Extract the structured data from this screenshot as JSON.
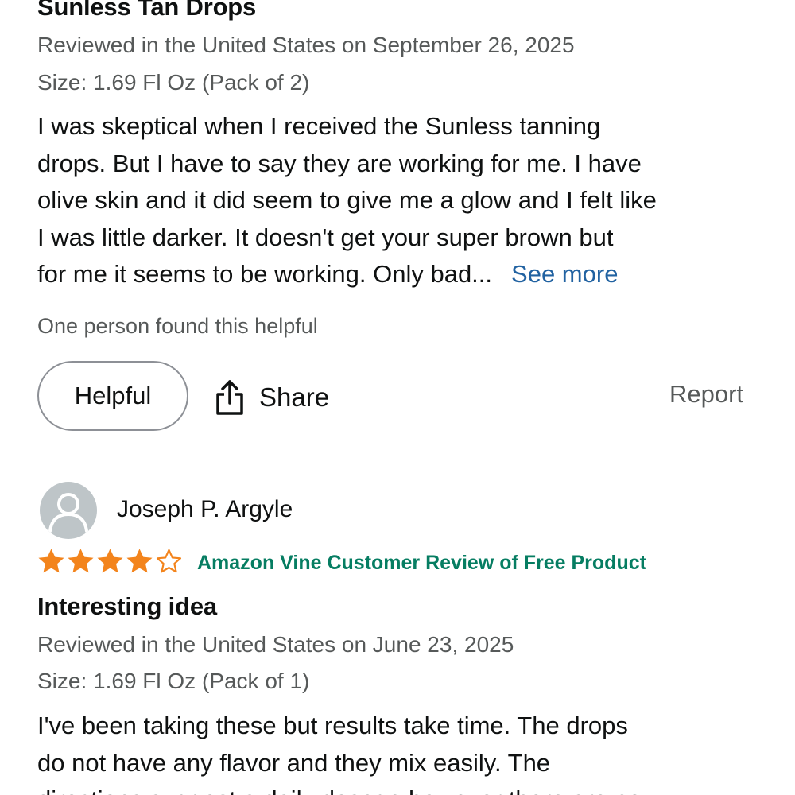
{
  "review1": {
    "title": "Sunless Tan Drops",
    "reviewed": "Reviewed in the United States on September 26, 2025",
    "size": "Size: 1.69 Fl Oz (Pack of 2)",
    "body_lines": [
      "I was skeptical when I received the Sunless tanning",
      "drops. But I have to say they are working for me. I have",
      "olive skin and it did seem to give me a glow and I felt like",
      "I was little darker. It doesn't get your super brown but",
      "for me it seems to be working. Only bad..."
    ],
    "see_more": "See more",
    "helpful_count": "One person found this helpful",
    "helpful_button": "Helpful",
    "share": "Share",
    "report": "Report"
  },
  "review2": {
    "reviewer": "Joseph P. Argyle",
    "rating": 4,
    "rating_max": 5,
    "vine_badge": "Amazon Vine Customer Review of Free Product",
    "title": "Interesting idea",
    "reviewed": "Reviewed in the United States on June 23, 2025",
    "size": "Size: 1.69 Fl Oz (Pack of 1)",
    "body_lines": [
      "I've been taking these but results take time. The drops",
      "do not have any flavor and they mix easily. The",
      "directions suggest a daily dosage however there are no"
    ]
  },
  "colors": {
    "star": "#f3841c",
    "vine": "#067d62",
    "link": "#2162a1",
    "secondary_text": "#565959"
  },
  "icons": {
    "share": "share-icon",
    "avatar": "user-avatar-icon",
    "star": "star-icon"
  }
}
